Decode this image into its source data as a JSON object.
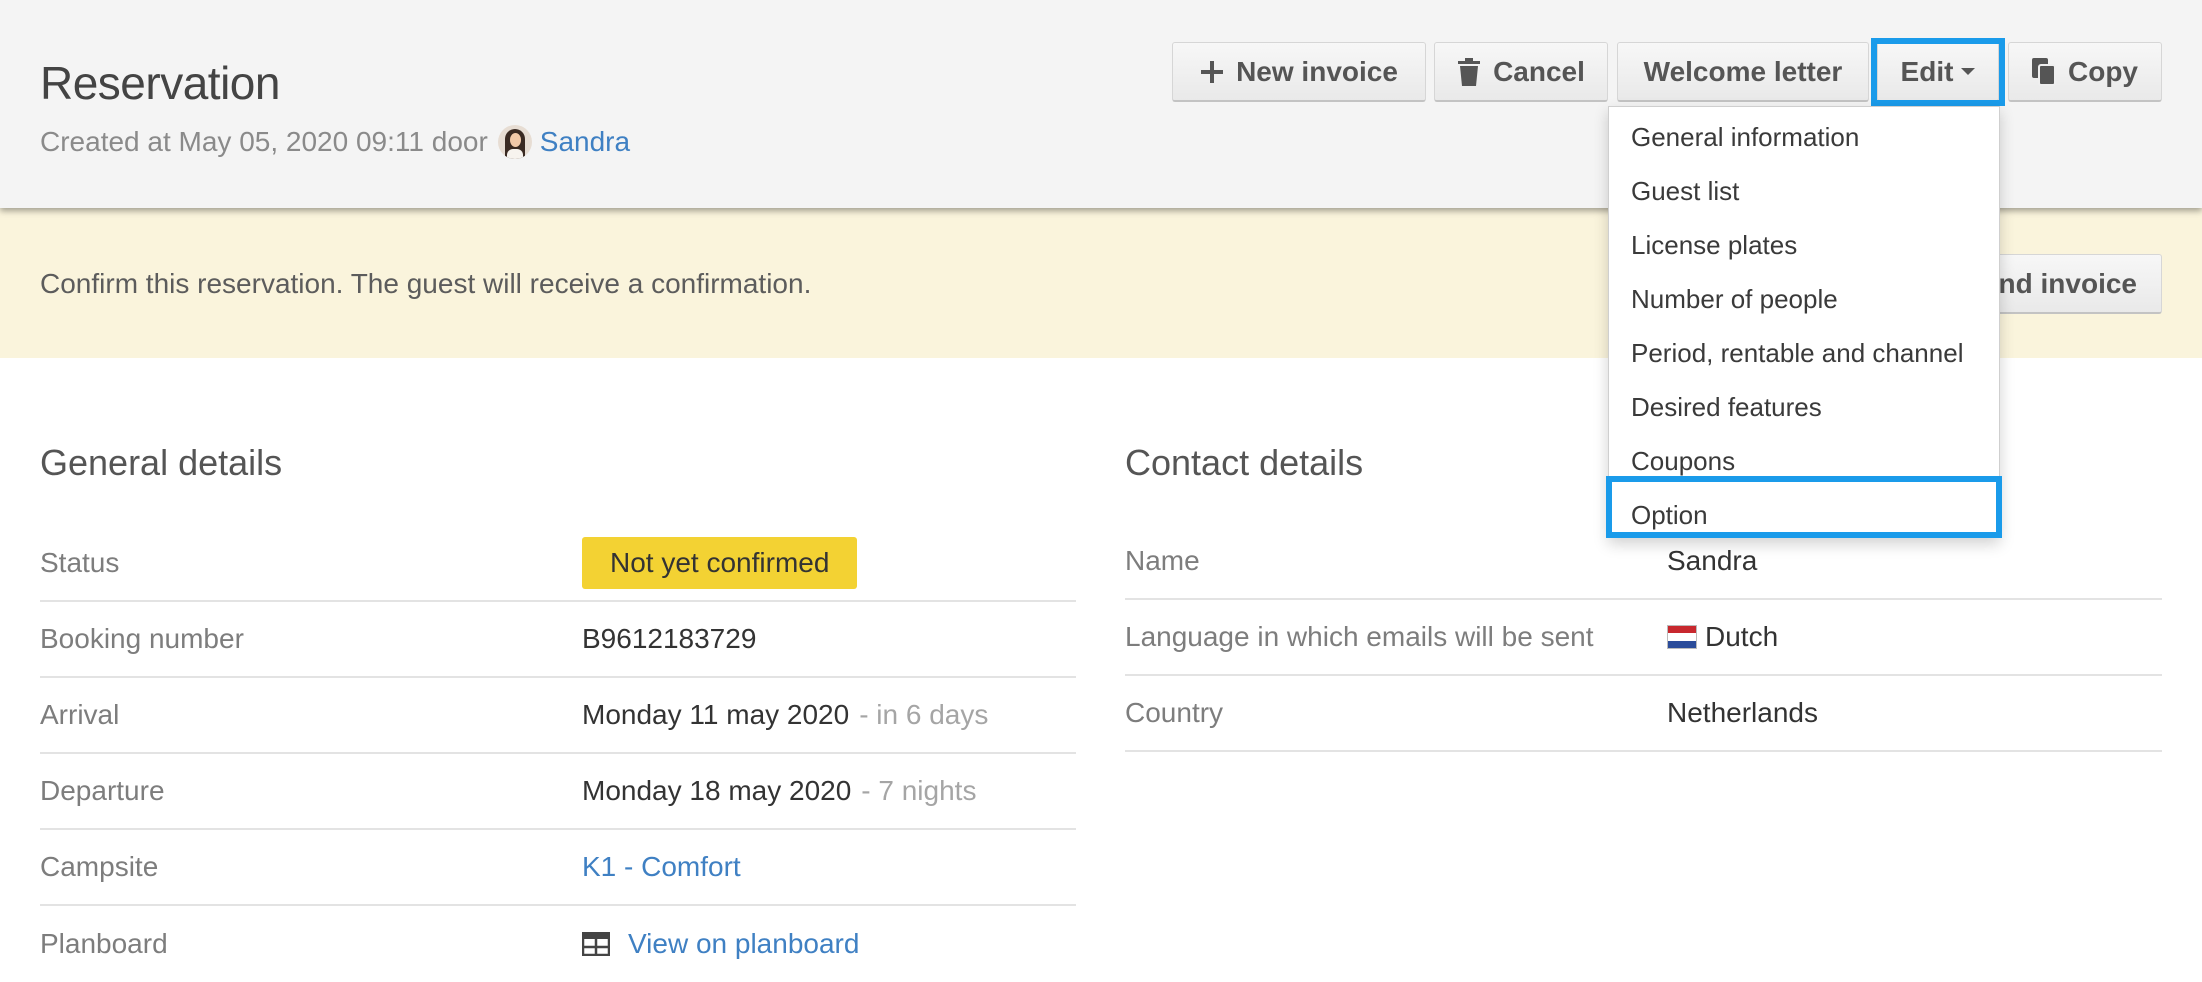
{
  "header": {
    "title": "Reservation",
    "created_prefix": "Created at May 05, 2020 09:11 door",
    "created_by": "Sandra"
  },
  "toolbar": {
    "new_invoice": "New invoice",
    "cancel": "Cancel",
    "welcome_letter": "Welcome letter",
    "edit": "Edit",
    "copy": "Copy"
  },
  "edit_menu": {
    "items": [
      "General information",
      "Guest list",
      "License plates",
      "Number of people",
      "Period, rentable and channel",
      "Desired features",
      "Coupons",
      "Option"
    ],
    "highlighted": "Option"
  },
  "banner": {
    "text": "Confirm this reservation. The guest will receive a confirmation.",
    "button_visible_label": "nd invoice"
  },
  "general_details": {
    "title": "General details",
    "status_label": "Status",
    "status_value": "Not yet confirmed",
    "booking_label": "Booking number",
    "booking_value": "B9612183729",
    "arrival_label": "Arrival",
    "arrival_value": "Monday 11 may 2020",
    "arrival_note": "- in 6 days",
    "departure_label": "Departure",
    "departure_value": "Monday 18 may 2020",
    "departure_note": "- 7 nights",
    "campsite_label": "Campsite",
    "campsite_value": "K1 - Comfort",
    "planboard_label": "Planboard",
    "planboard_value": "View on planboard"
  },
  "contact_details": {
    "title": "Contact details",
    "name_label": "Name",
    "name_value": "Sandra",
    "language_label": "Language in which emails will be sent",
    "language_value": "Dutch",
    "country_label": "Country",
    "country_value": "Netherlands"
  },
  "colors": {
    "link": "#3f80c3",
    "status_badge": "#f3d233",
    "highlight_outline": "#1a9bea",
    "banner_background": "#faf4dc"
  },
  "icons": [
    "plus-icon",
    "trash-icon",
    "caret-down-icon",
    "copy-icon",
    "table-icon",
    "dutch-flag-icon",
    "avatar"
  ]
}
